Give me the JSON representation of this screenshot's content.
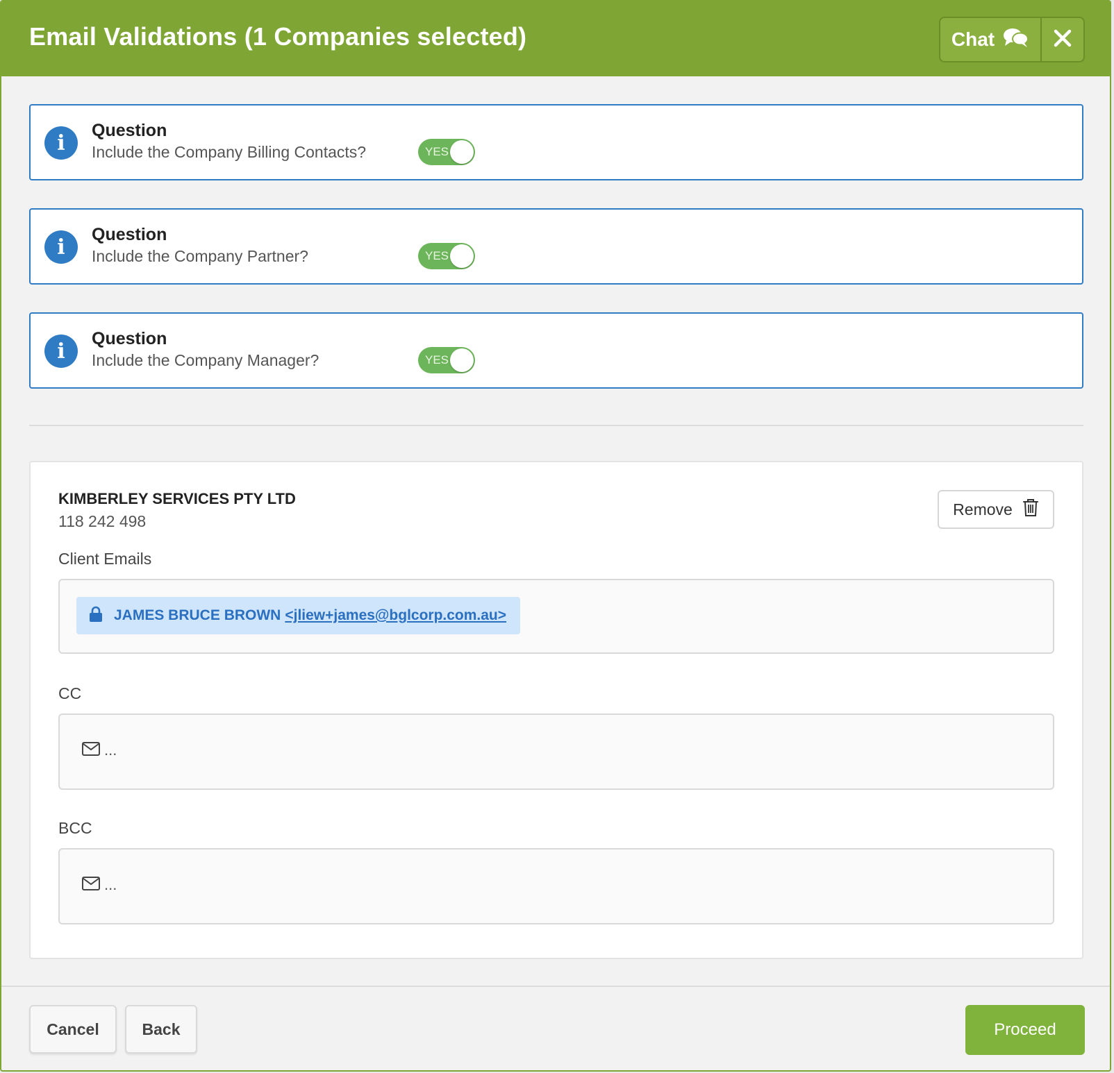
{
  "header": {
    "title": "Email Validations (1 Companies selected)",
    "chat_label": "Chat",
    "chat_icon": "chat-bubbles-icon",
    "close_icon": "close-icon"
  },
  "questions": [
    {
      "title": "Question",
      "text": "Include the Company Billing Contacts?",
      "toggle_label": "YES",
      "toggle_on": true
    },
    {
      "title": "Question",
      "text": "Include the Company Partner?",
      "toggle_label": "YES",
      "toggle_on": true
    },
    {
      "title": "Question",
      "text": "Include the Company Manager?",
      "toggle_label": "YES",
      "toggle_on": true
    }
  ],
  "company": {
    "name": "KIMBERLEY SERVICES PTY LTD",
    "abn": "118 242 498",
    "remove_label": "Remove",
    "client_emails_label": "Client Emails",
    "client_email_chip": {
      "name": "JAMES BRUCE BROWN",
      "email": "<jliew+james@bglcorp.com.au>"
    },
    "cc_label": "CC",
    "cc_placeholder": "...",
    "bcc_label": "BCC",
    "bcc_placeholder": "..."
  },
  "footer": {
    "cancel_label": "Cancel",
    "back_label": "Back",
    "proceed_label": "Proceed"
  },
  "colors": {
    "header_green": "#7fa534",
    "question_border": "#2f7cc4",
    "toggle_green": "#6cb55a",
    "chip_bg": "#cfe5fb",
    "proceed_green": "#80b33c"
  }
}
